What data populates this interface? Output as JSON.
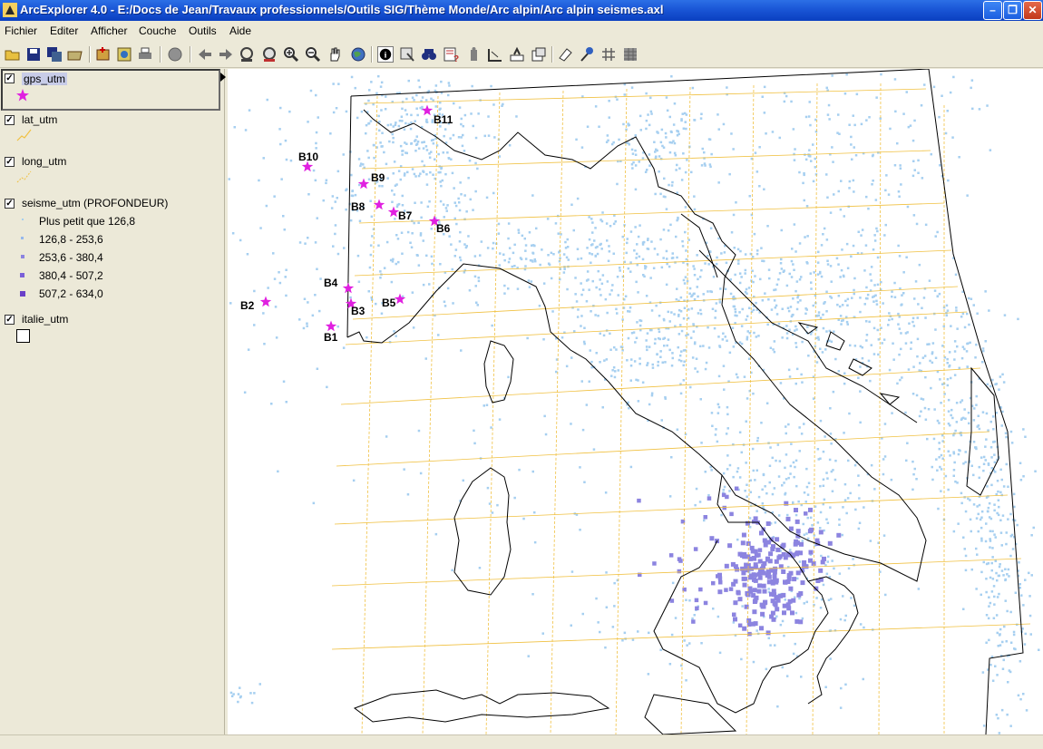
{
  "window": {
    "title": "ArcExplorer 4.0 - E:/Docs de Jean/Travaux professionnels/Outils SIG/Thème Monde/Arc alpin/Arc alpin seismes.axl"
  },
  "menu": [
    "Fichier",
    "Editer",
    "Afficher",
    "Couche",
    "Outils",
    "Aide"
  ],
  "toolbar_icons": [
    "open-icon",
    "save-icon",
    "save-as-icon",
    "open-layer-icon",
    "add-layer-icon",
    "add-image-icon",
    "print-icon",
    "stop-icon",
    "zoom-previous-icon",
    "zoom-next-icon",
    "full-extent-icon",
    "zoom-layer-icon",
    "zoom-in-icon",
    "zoom-out-icon",
    "pan-icon",
    "globe-icon",
    "identify-icon",
    "select-icon",
    "find-icon",
    "query-icon",
    "attribute-icon",
    "measure-icon",
    "hyperlink-icon",
    "buffer-icon",
    "properties-icon",
    "erase-icon",
    "tool-icon",
    "graticule-icon",
    "table-icon"
  ],
  "legend": {
    "layers": [
      {
        "name": "gps_utm",
        "checked": true,
        "symbol": "star-icon",
        "color": "#e020e0"
      },
      {
        "name": "lat_utm",
        "checked": true,
        "symbol": "line-icon",
        "color": "#f0c040"
      },
      {
        "name": "long_utm",
        "checked": true,
        "symbol": "dashed-line-icon",
        "color": "#f0c040"
      },
      {
        "name": "seisme_utm (PROFONDEUR)",
        "checked": true,
        "symbol": "",
        "classes": [
          {
            "label": "Plus petit que 126,8",
            "color": "#a6cff0"
          },
          {
            "label": "126,8 - 253,6",
            "color": "#96b8ec"
          },
          {
            "label": "253,6 - 380,4",
            "color": "#8c84e0"
          },
          {
            "label": "380,4 - 507,2",
            "color": "#7a60d8"
          },
          {
            "label": "507,2 - 634,0",
            "color": "#6a40c8"
          }
        ]
      },
      {
        "name": "italie_utm",
        "checked": true,
        "symbol": "polygon-icon",
        "color": "#000000"
      }
    ]
  },
  "map": {
    "stations": [
      "B1",
      "B2",
      "B3",
      "B4",
      "B5",
      "B6",
      "B7",
      "B8",
      "B9",
      "B10",
      "B11"
    ],
    "colors": {
      "quake_shallow": "#a6cff0",
      "quake_deep": "#8c84e0",
      "graticule": "#f0c040",
      "station": "#e020e0",
      "coast": "#000000"
    }
  }
}
